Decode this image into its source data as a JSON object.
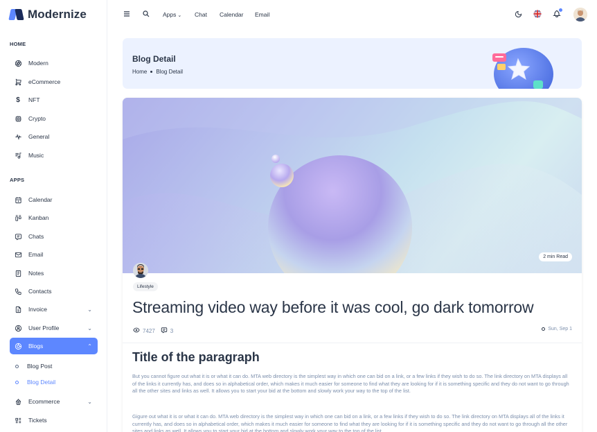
{
  "brand": {
    "name": "Modernize"
  },
  "sidebar": {
    "home_caption": "HOME",
    "home_items": [
      {
        "label": "Modern",
        "icon": "aperture-icon"
      },
      {
        "label": "eCommerce",
        "icon": "shopping-cart-icon"
      },
      {
        "label": "NFT",
        "icon": "currency-dollar-icon"
      },
      {
        "label": "Crypto",
        "icon": "cpu-icon"
      },
      {
        "label": "General",
        "icon": "activity-heartbeat-icon"
      },
      {
        "label": "Music",
        "icon": "playlist-icon"
      }
    ],
    "apps_caption": "APPS",
    "apps_items": [
      {
        "label": "Calendar",
        "icon": "calendar-icon"
      },
      {
        "label": "Kanban",
        "icon": "layout-kanban-icon"
      },
      {
        "label": "Chats",
        "icon": "message-icon"
      },
      {
        "label": "Email",
        "icon": "mail-icon"
      },
      {
        "label": "Notes",
        "icon": "notes-icon"
      },
      {
        "label": "Contacts",
        "icon": "phone-icon"
      },
      {
        "label": "Invoice",
        "icon": "file-text-icon"
      },
      {
        "label": "User Profile",
        "icon": "user-circle-icon"
      },
      {
        "label": "Blogs",
        "icon": "chart-donut-icon"
      },
      {
        "label": "Ecommerce",
        "icon": "basket-icon"
      },
      {
        "label": "Tickets",
        "icon": "ticket-icon"
      }
    ],
    "blog_subitems": [
      {
        "label": "Blog Post"
      },
      {
        "label": "Blog Detail"
      }
    ]
  },
  "topbar": {
    "links": [
      "Apps",
      "Chat",
      "Calendar",
      "Email"
    ],
    "icons": [
      "menu-icon",
      "search-icon",
      "moon-icon",
      "flag-uk-icon",
      "bell-icon",
      "user-avatar-icon"
    ]
  },
  "breadcrumb": {
    "title": "Blog Detail",
    "home": "Home",
    "current": "Blog Detail"
  },
  "post": {
    "read_time": "2 min Read",
    "category": "Lifestyle",
    "title": "Streaming video way before it was cool, go dark tomorrow",
    "views": "7427",
    "comments": "3",
    "date": "Sun, Sep 1",
    "section_title": "Title of the paragraph",
    "paragraph1": "But you cannot figure out what it is or what it can do. MTA web directory is the simplest way in which one can bid on a link, or a few links if they wish to do so. The link directory on MTA displays all of the links it currently has, and does so in alphabetical order, which makes it much easier for someone to find what they are looking for if it is something specific and they do not want to go through all the other sites and links as well. It allows you to start your bid at the bottom and slowly work your way to the top of the list.",
    "paragraph2": "Gigure out what it is or what it can do. MTA web directory is the simplest way in which one can bid on a link, or a few links if they wish to do so. The link directory on MTA displays all of the links it currently has, and does so in alphabetical order, which makes it much easier for someone to find what they are looking for if it is something specific and they do not want to go through all the other sites and links as well. It allows you to start your bid at the bottom and slowly work your way to the top of the list."
  },
  "colors": {
    "primary": "#5d87ff",
    "breadcrumb_bg": "#ecf2ff",
    "text": "#2a3547",
    "muted": "#7c8fac"
  }
}
